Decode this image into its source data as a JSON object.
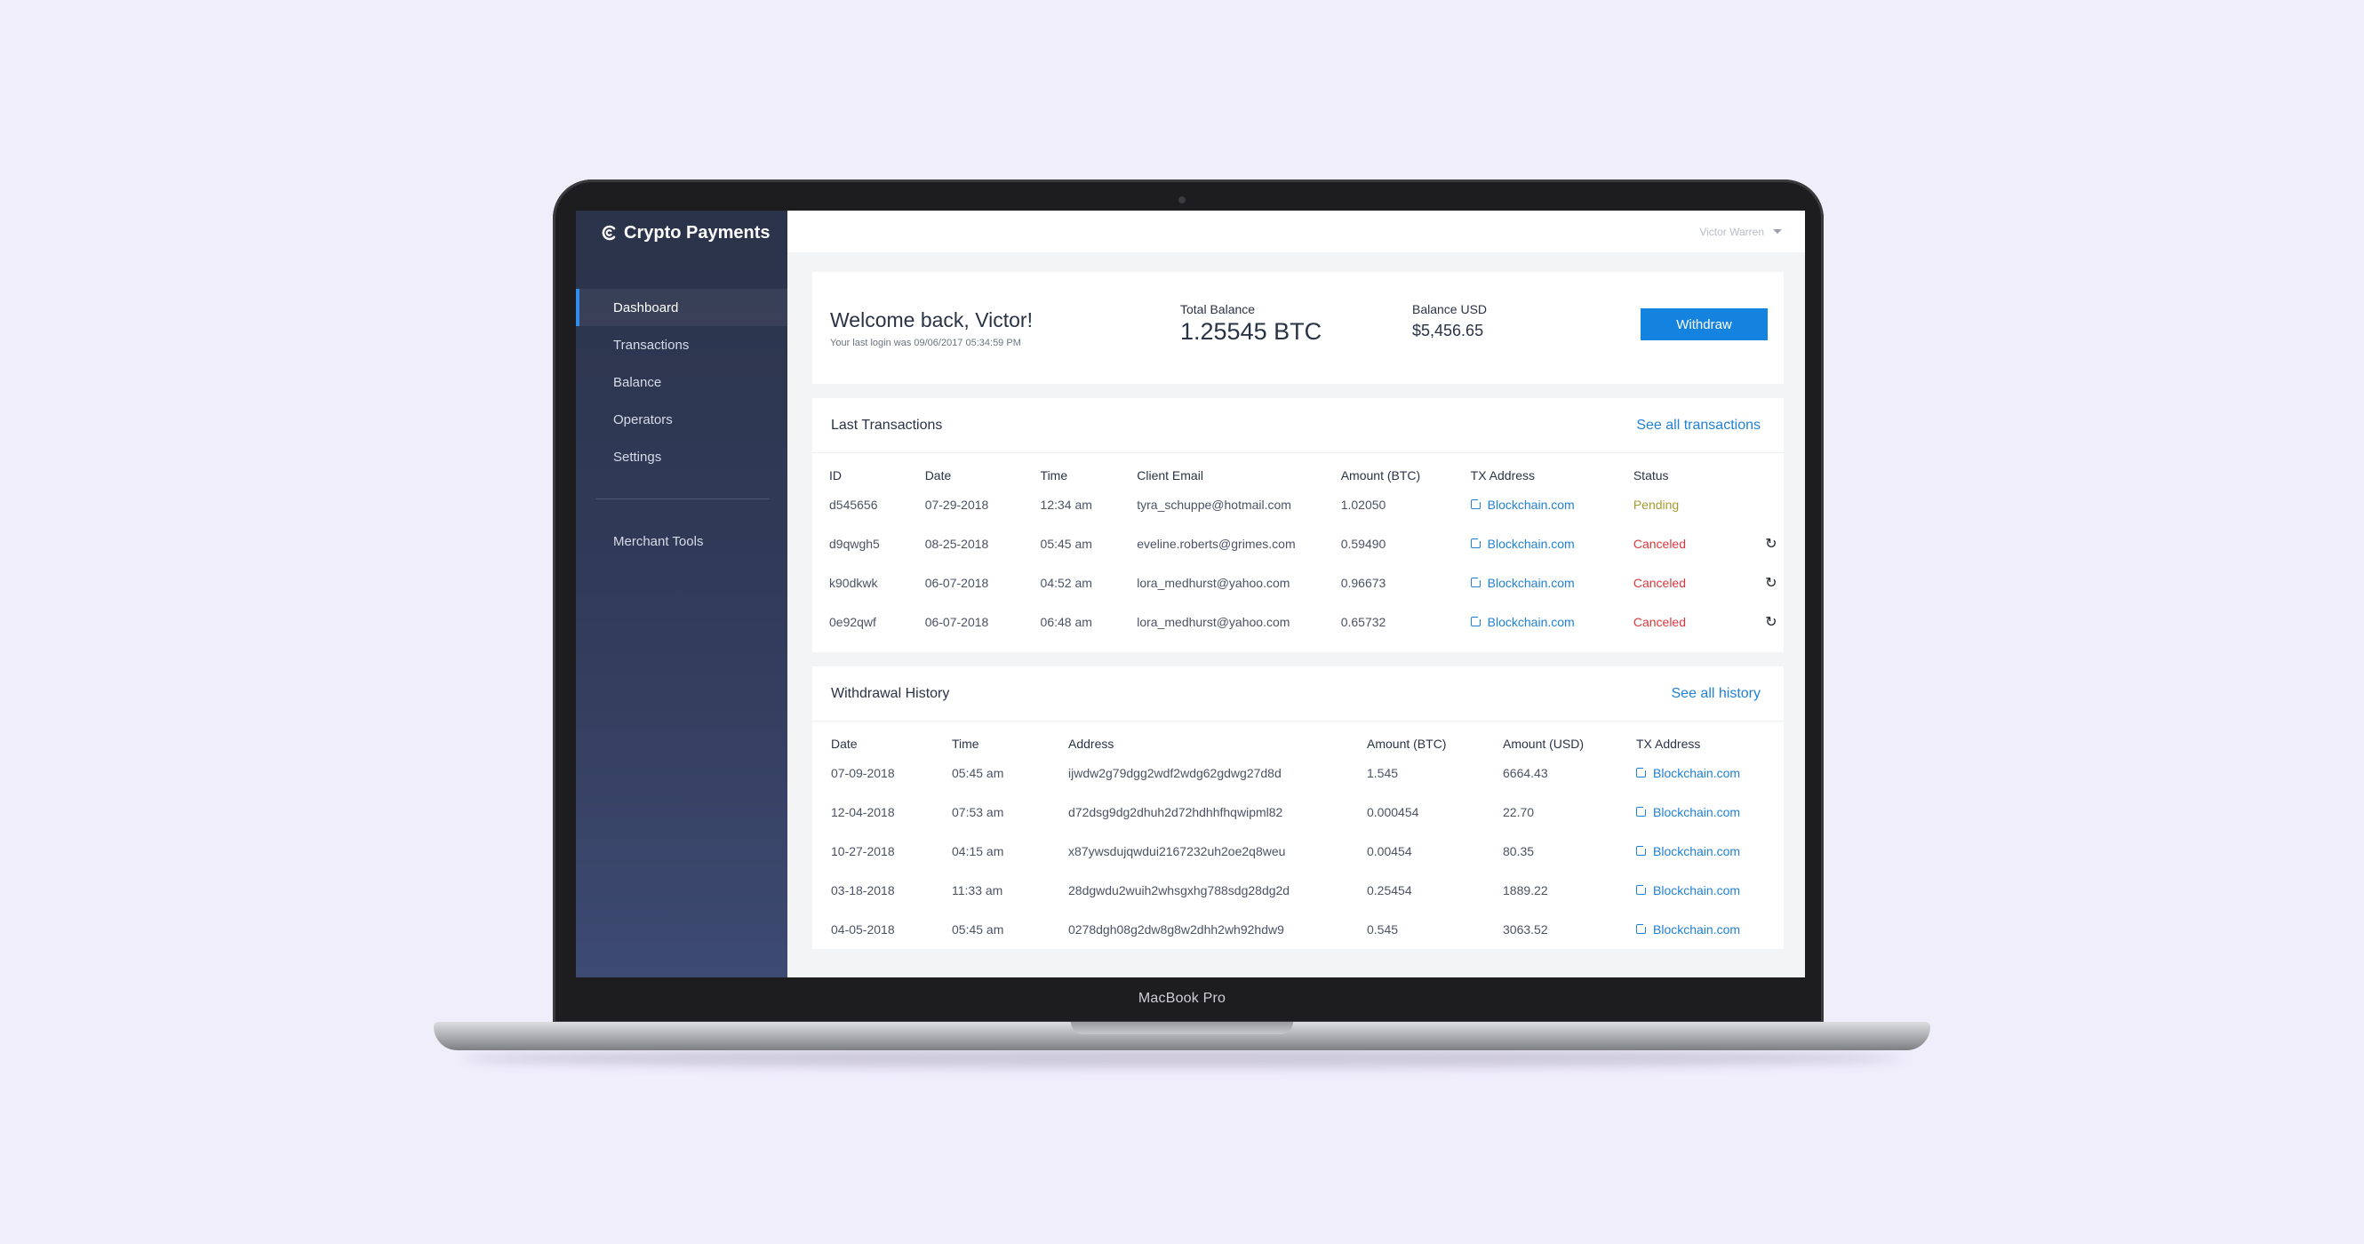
{
  "device": {
    "label": "MacBook Pro"
  },
  "app": {
    "name": "Crypto Payments"
  },
  "user": {
    "name": "Victor Warren"
  },
  "sidebar": {
    "items": [
      {
        "label": "Dashboard",
        "active": true
      },
      {
        "label": "Transactions"
      },
      {
        "label": "Balance"
      },
      {
        "label": "Operators"
      },
      {
        "label": "Settings"
      }
    ],
    "secondary": [
      {
        "label": "Merchant Tools"
      }
    ]
  },
  "welcome": {
    "title": "Welcome back, Victor!",
    "last_login": "Your last login was 09/06/2017 05:34:59 PM",
    "total_balance_label": "Total Balance",
    "total_balance_value": "1.25545 BTC",
    "balance_usd_label": "Balance USD",
    "balance_usd_value": "$5,456.65",
    "withdraw_label": "Withdraw"
  },
  "transactions": {
    "title": "Last Transactions",
    "see_all": "See all transactions",
    "columns": [
      "ID",
      "Date",
      "Time",
      "Client Email",
      "Amount (BTC)",
      "TX Address",
      "Status"
    ],
    "rows": [
      {
        "id": "d545656",
        "date": "07-29-2018",
        "time": "12:34 am",
        "email": "tyra_schuppe@hotmail.com",
        "amount": "1.02050",
        "tx": "Blockchain.com",
        "status": "Pending"
      },
      {
        "id": "d9qwgh5",
        "date": "08-25-2018",
        "time": "05:45 am",
        "email": "eveline.roberts@grimes.com",
        "amount": "0.59490",
        "tx": "Blockchain.com",
        "status": "Canceled"
      },
      {
        "id": "k90dkwk",
        "date": "06-07-2018",
        "time": "04:52 am",
        "email": "lora_medhurst@yahoo.com",
        "amount": "0.96673",
        "tx": "Blockchain.com",
        "status": "Canceled"
      },
      {
        "id": "0e92qwf",
        "date": "06-07-2018",
        "time": "06:48 am",
        "email": "lora_medhurst@yahoo.com",
        "amount": "0.65732",
        "tx": "Blockchain.com",
        "status": "Canceled"
      }
    ]
  },
  "withdrawals": {
    "title": "Withdrawal History",
    "see_all": "See all history",
    "columns": [
      "Date",
      "Time",
      "Address",
      "Amount (BTC)",
      "Amount (USD)",
      "TX Address"
    ],
    "rows": [
      {
        "date": "07-09-2018",
        "time": "05:45 am",
        "address": "ijwdw2g79dgg2wdf2wdg62gdwg27d8d",
        "btc": "1.545",
        "usd": "6664.43",
        "tx": "Blockchain.com"
      },
      {
        "date": "12-04-2018",
        "time": "07:53 am",
        "address": "d72dsg9dg2dhuh2d72hdhhfhqwipml82",
        "btc": "0.000454",
        "usd": "22.70",
        "tx": "Blockchain.com"
      },
      {
        "date": "10-27-2018",
        "time": "04:15 am",
        "address": "x87ywsdujqwdui2167232uh2oe2q8weu",
        "btc": "0.00454",
        "usd": "80.35",
        "tx": "Blockchain.com"
      },
      {
        "date": "03-18-2018",
        "time": "11:33 am",
        "address": "28dgwdu2wuih2whsgxhg788sdg28dg2d",
        "btc": "0.25454",
        "usd": "1889.22",
        "tx": "Blockchain.com"
      },
      {
        "date": "04-05-2018",
        "time": "05:45 am",
        "address": "0278dgh08g2dw8g8w2dhh2wh92hdw9",
        "btc": "0.545",
        "usd": "3063.52",
        "tx": "Blockchain.com"
      }
    ]
  },
  "colors": {
    "accent": "#1483e0",
    "link": "#2181d4",
    "pending": "#a59a2e",
    "canceled": "#d8383c",
    "sidebar": "#2f3850",
    "background": "#f1eefc"
  },
  "icons": {
    "logo": "brand-c-icon",
    "external": "external-link-icon",
    "retry": "refresh-icon",
    "dropdown": "chevron-down-icon"
  }
}
